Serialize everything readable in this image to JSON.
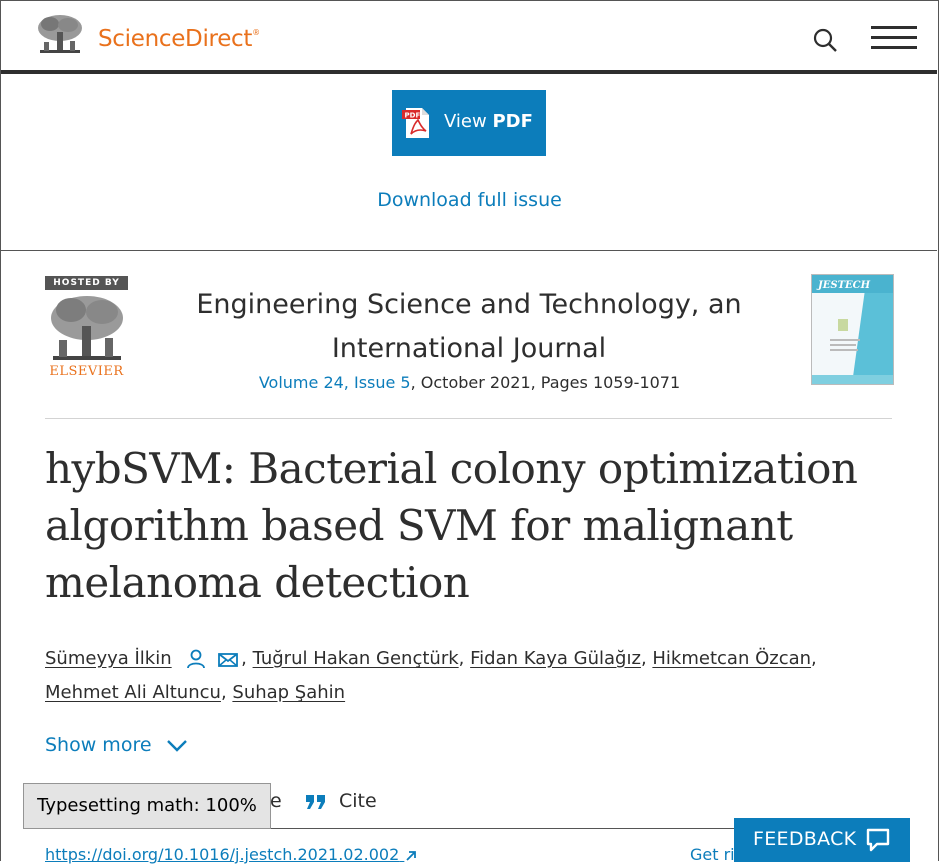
{
  "header": {
    "brand": "ScienceDirect",
    "brand_mark": "®",
    "brand_color": "#e9711c",
    "search_icon": "search-icon",
    "menu_icon": "hamburger-menu-icon"
  },
  "pdf_panel": {
    "view_pdf_prefix": "View",
    "view_pdf_strong": "PDF",
    "pdf_icon_label": "PDF",
    "download_issue": "Download full issue",
    "accent_color": "#0c7dbb"
  },
  "journal": {
    "hosted_by": "HOSTED BY",
    "publisher": "ELSEVIER",
    "title": "Engineering Science and Technology, an International Journal",
    "volume_issue": "Volume 24, Issue 5",
    "date_pages": ", October 2021, Pages 1059-1071",
    "cover_label": "JESTECH"
  },
  "article": {
    "title": "hybSVM: Bacterial colony optimization algorithm based SVM for malignant melanoma detection",
    "authors": [
      {
        "name": "Sümeyya İlkin",
        "has_icons": true
      },
      {
        "name": "Tuğrul Hakan Gençtürk"
      },
      {
        "name": "Fidan Kaya Gülağız"
      },
      {
        "name": "Hikmetcan Özcan"
      },
      {
        "name": "Mehmet Ali Altuncu"
      },
      {
        "name": "Suhap Şahin"
      }
    ],
    "show_more": "Show more",
    "share_partial": "e",
    "cite": "Cite",
    "doi": "https://doi.org/10.1016/j.jestch.2021.02.002",
    "rights_partial": "Get ri"
  },
  "overlays": {
    "mathjax_status": "Typesetting math: 100%",
    "feedback": "FEEDBACK"
  }
}
